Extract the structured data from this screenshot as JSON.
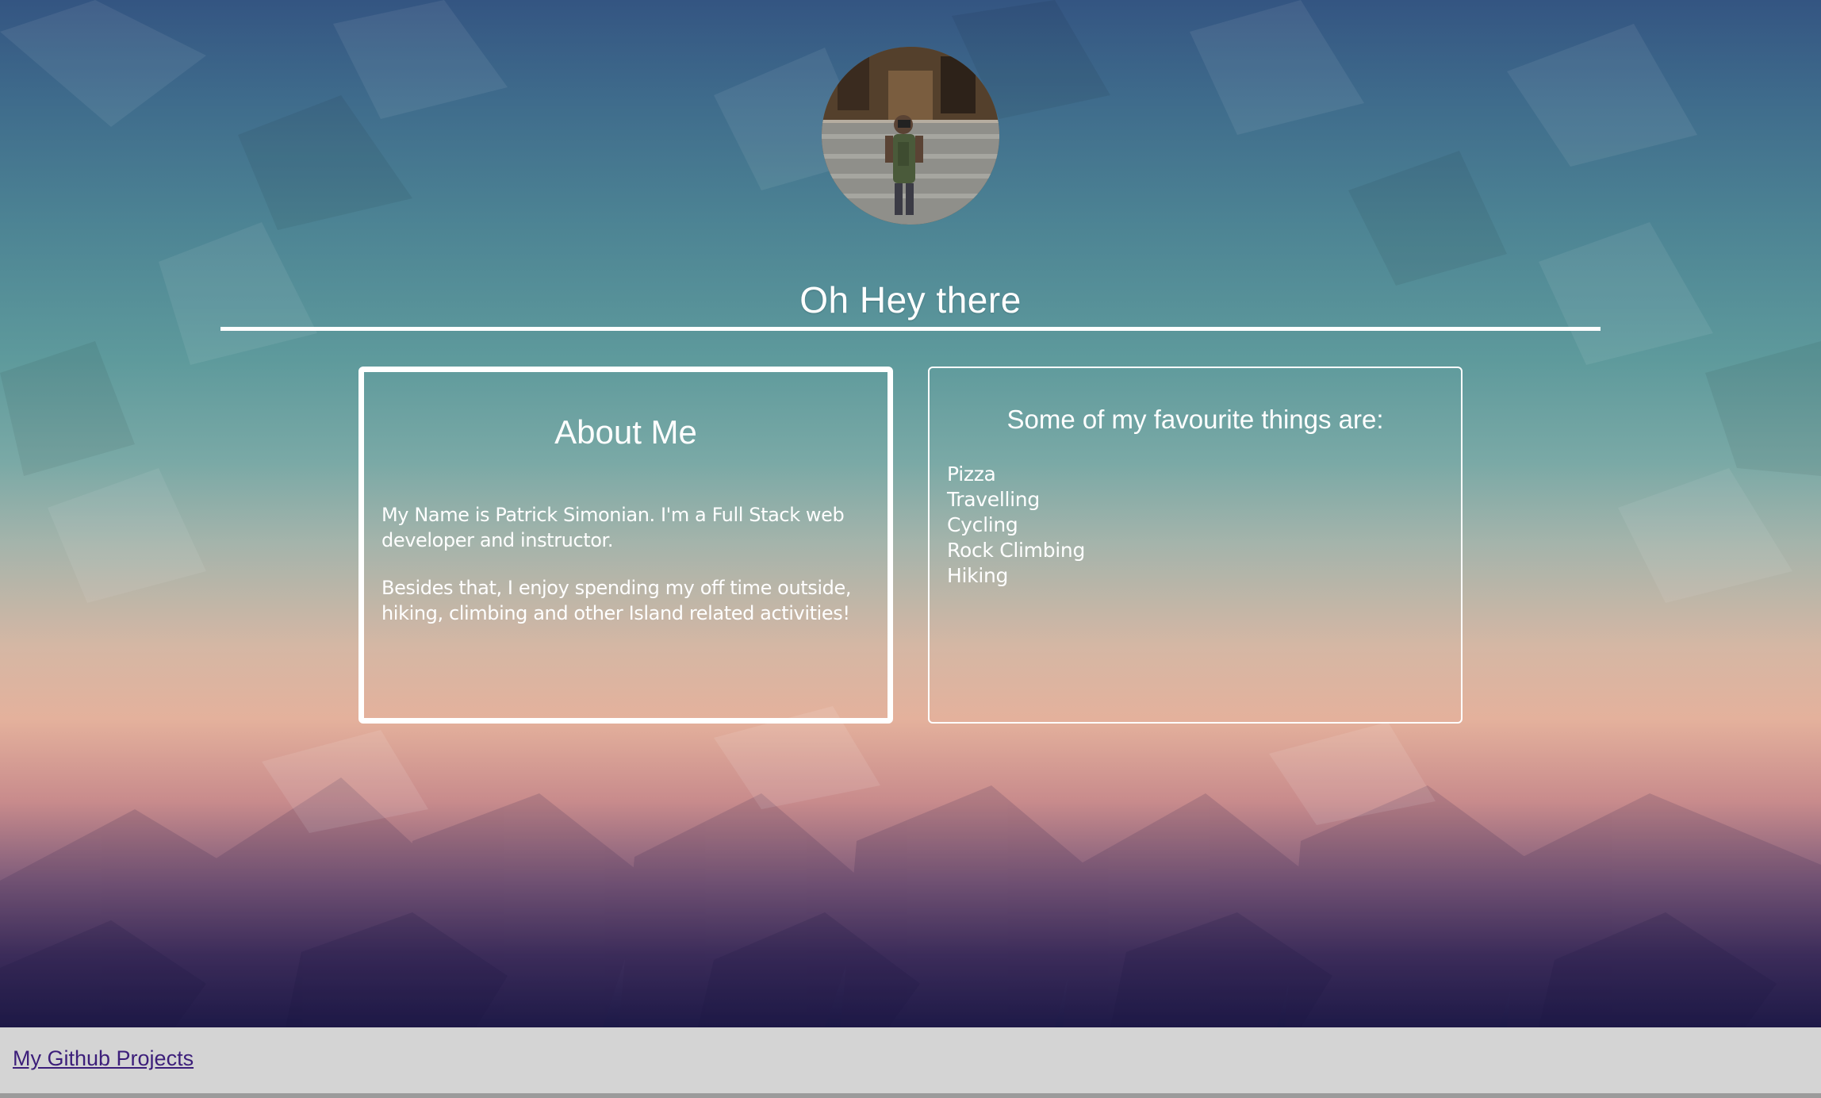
{
  "hero": {
    "title": "Oh Hey there"
  },
  "about": {
    "title": "About Me",
    "paragraphs": [
      "My Name is Patrick Simonian. I'm a Full Stack web developer and instructor.",
      "Besides that, I enjoy spending my off time outside, hiking, climbing and other Island related activities!"
    ]
  },
  "favourites": {
    "title": "Some of my favourite things are:",
    "items": [
      "Pizza",
      "Travelling",
      "Cycling",
      "Rock Climbing",
      "Hiking"
    ]
  },
  "footer": {
    "link_label": "My Github Projects"
  },
  "colors": {
    "footer_bg": "#d4d4d4",
    "link": "#3c1e7a",
    "card_border": "#ffffff"
  }
}
